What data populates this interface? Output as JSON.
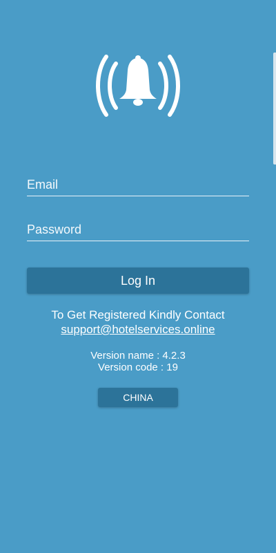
{
  "login": {
    "email_placeholder": "Email",
    "password_placeholder": "Password",
    "login_button_label": "Log In"
  },
  "contact": {
    "message": "To Get Registered Kindly Contact",
    "email": "support@hotelservices.online"
  },
  "version": {
    "name_text": "Version name : 4.2.3",
    "code_text": "Version code : 19"
  },
  "region": {
    "button_label": "CHINA"
  },
  "theme": {
    "background": "#4a9cc7",
    "button": "#2c7399",
    "text": "#ffffff"
  },
  "icons": {
    "logo": "bell-alarm-icon"
  }
}
